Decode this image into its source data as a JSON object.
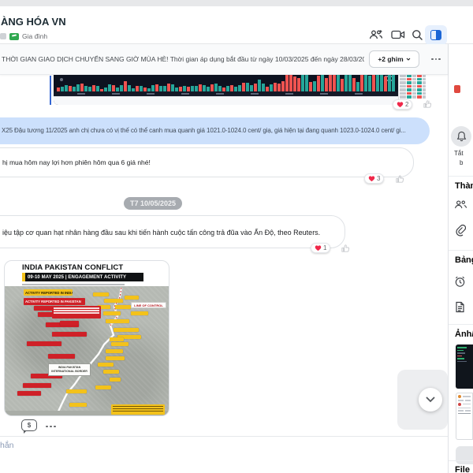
{
  "header": {
    "title": "ÀNG HÓA VN",
    "subtitle": "Gia đình",
    "icons": {
      "add_members": "people-plus",
      "video_call": "camera",
      "search": "magnifier",
      "toggle_sidebar": "panel-right"
    }
  },
  "pinned": {
    "text": "THỜI GIAN GIAO DỊCH CHUYỂN SANG GIỜ MÙA HÈ! Thời gian áp dụng bắt đầu từ ngày 10/03/2025 đến ngày 28/03/2025...",
    "pin_button": "+2 ghim"
  },
  "chat": {
    "date_divider": "T7 10/05/2025",
    "messages": [
      {
        "kind": "image-chart",
        "reaction_count": "2"
      },
      {
        "kind": "text",
        "text": "X25 Đậu tương 11/2025 anh chị chưa có vị thế có thể canh mua quanh giá 1021.0-1024.0 cent/ giạ, giá hiện tại đang quanh 1023.0-1024.0 cent/ gi...",
        "reaction_count": ""
      },
      {
        "kind": "text",
        "text": "hị mua hôm nay lợi hơn phiên hôm qua 6 giá nhé!",
        "reaction_count": "3"
      },
      {
        "kind": "text",
        "text": "iệu tập cơ quan hạt nhân hàng đầu sau khi tiến hành cuộc tấn công trả đũa vào Ấn Độ, theo Reuters.",
        "reaction_count": "1"
      },
      {
        "kind": "image-map",
        "reaction_count": ""
      }
    ]
  },
  "map_infographic": {
    "title": "INDIA PAKISTAN CONFLICT",
    "subtitle": "09-10 MAY 2025 | ENGAGEMENT ACTIVITY",
    "legend_india": "ACTIVITY REPORTED IN INDIA",
    "legend_pakistan": "ACTIVITY REPORTED IN PAKISTAN",
    "line_of_control": "LINE OF CONTROL",
    "border_label": "INDIA PAKISTAN INTERNATIONAL BORDER"
  },
  "sidebar": {
    "mute_label": "Tắt",
    "mute_label2": "b",
    "members_header": "Thàn",
    "board_header": "Bảng",
    "media_header": "Ảnh/",
    "files_header": "File"
  },
  "composer": {
    "placeholder_fragment": "hắn",
    "bubble_glyph": "$"
  },
  "colors": {
    "accent_blue": "#1b66d6",
    "bubble_blue": "#cce0fc",
    "reaction_red": "#f0284a",
    "chart_green": "#26a69a",
    "chart_red": "#ef5350",
    "map_yellow": "#f3c21b",
    "map_red": "#cf2027",
    "tag_green": "#2fa84f"
  }
}
